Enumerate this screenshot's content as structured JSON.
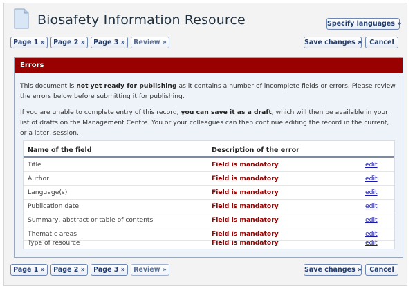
{
  "header": {
    "title": "Biosafety Information Resource",
    "specify_languages": "Specify languages »"
  },
  "nav": {
    "page1": "Page 1 »",
    "page2": "Page 2 »",
    "page3": "Page 3 »",
    "review": "Review »",
    "save": "Save changes »",
    "cancel": "Cancel"
  },
  "errors": {
    "heading": "Errors",
    "p1": {
      "before": "This document is ",
      "bold": "not yet ready for publishing",
      "after": " as it contains a number of incomplete fields or errors. Please review the errors below before submitting it for publishing."
    },
    "p2": {
      "before": "If you are unable to complete entry of this record, ",
      "bold": "you can save it as a draft",
      "after": ", which will then be available in your list of drafts on the Management Centre. You or your colleagues can then continue editing the record in the current, or a later, session."
    },
    "table": {
      "col_field": "Name of the field",
      "col_error": "Description of the error",
      "rows": [
        {
          "field": "Title",
          "error": "Field is mandatory",
          "action": "edit"
        },
        {
          "field": "Author",
          "error": "Field is mandatory",
          "action": "edit"
        },
        {
          "field": "Language(s)",
          "error": "Field is mandatory",
          "action": "edit"
        },
        {
          "field": "Publication date",
          "error": "Field is mandatory",
          "action": "edit"
        },
        {
          "field": "Summary, abstract or table of contents",
          "error": "Field is mandatory",
          "action": "edit"
        },
        {
          "field": "Thematic areas",
          "error": "Field is mandatory",
          "action": "edit"
        },
        {
          "field": "Type of resource",
          "error": "Field is mandatory",
          "action": "edit"
        }
      ]
    }
  }
}
